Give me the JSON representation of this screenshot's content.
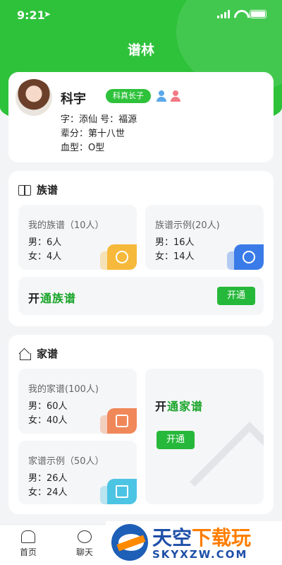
{
  "status_bar": {
    "time": "9:21"
  },
  "header": {
    "title": "谱林"
  },
  "profile": {
    "name": "科宇",
    "badge": "科真长子",
    "courtesy": "字：添仙  号：福源",
    "generation": "辈分：第十八世",
    "blood": "血型：O型"
  },
  "zupu": {
    "title": "族谱",
    "tiles": [
      {
        "title": "我的族谱（10人）",
        "male": "男：6人",
        "female": "女：4人",
        "color": "#f6b93b"
      },
      {
        "title": "族谱示例(20人)",
        "male": "男：16人",
        "female": "女：14人",
        "color": "#3a7be8"
      }
    ],
    "open": {
      "brand_a": "开",
      "brand_b": "通族谱",
      "button": "开通"
    }
  },
  "jiapu": {
    "title": "家谱",
    "tiles": [
      {
        "title": "我的家谱(100人)",
        "male": "男：60人",
        "female": "女：40人",
        "color": "#f0885a"
      },
      {
        "title": "家谱示例（50人）",
        "male": "男：26人",
        "female": "女：24人",
        "color": "#4cc4e3"
      }
    ],
    "open": {
      "brand_a": "开",
      "brand_b": "通家谱",
      "button": "开通"
    }
  },
  "tabbar": {
    "home": "首页",
    "chat": "聊天"
  },
  "watermark": {
    "cn_a": "天空",
    "cn_b": "下载玩",
    "en": "SKYXZW.COM"
  },
  "colors": {
    "primary": "#2ec23b",
    "button": "#26b83a"
  }
}
